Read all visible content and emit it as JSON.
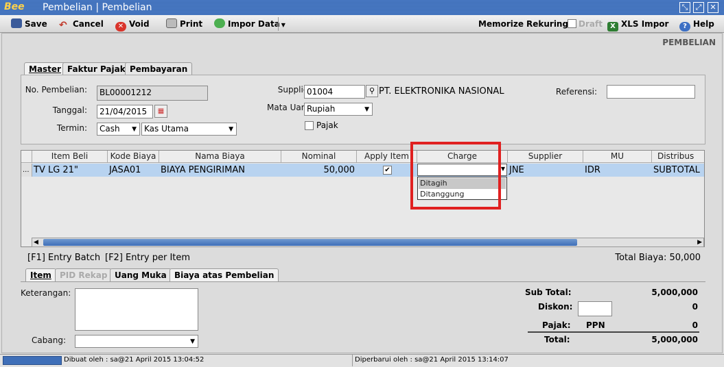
{
  "window": {
    "logo": "Bee",
    "title": "Pembelian | Pembelian"
  },
  "toolbar": {
    "save": "Save",
    "cancel": "Cancel",
    "void": "Void",
    "print": "Print",
    "impor_data": "Impor Data",
    "memorize": "Memorize",
    "rekuring": "Rekuring",
    "draft": "Draft",
    "xls_impor": "XLS Impor",
    "help": "Help"
  },
  "page_heading": "PEMBELIAN",
  "top_tabs": [
    "Master",
    "Faktur Pajak",
    "Pembayaran"
  ],
  "master": {
    "no_pembelian_label": "No. Pembelian:",
    "no_pembelian": "BL00001212",
    "tanggal_label": "Tanggal:",
    "tanggal": "21/04/2015",
    "termin_label": "Termin:",
    "termin": "Cash",
    "kas": "Kas Utama",
    "supplier_label": "Supplier:",
    "supplier_code": "01004",
    "supplier_name": "PT. ELEKTRONIKA NASIONAL",
    "mata_uang_label": "Mata Uang:",
    "mata_uang": "Rupiah",
    "pajak_label": "Pajak",
    "referensi_label": "Referensi:",
    "referensi": ""
  },
  "grid": {
    "columns": [
      "Item Beli",
      "Kode Biaya",
      "Nama Biaya",
      "Nominal",
      "Apply Item",
      "Charge",
      "Supplier",
      "MU",
      "Distribus"
    ],
    "row": {
      "marker": "...",
      "item_beli": "TV LG 21\"",
      "kode_biaya": "JASA01",
      "nama_biaya": "BIAYA PENGIRIMAN",
      "nominal": "50,000",
      "apply_item": true,
      "charge": "",
      "supplier": "JNE",
      "mu": "IDR",
      "distribusi": "SUBTOTAL"
    },
    "charge_options": [
      "Ditagih",
      "Ditanggung"
    ]
  },
  "hints": {
    "f1": "[F1] Entry Batch",
    "f2": "[F2] Entry per Item",
    "total_biaya": "Total Biaya: 50,000"
  },
  "bottom_tabs": [
    "Item",
    "PID Rekap",
    "Uang Muka",
    "Biaya atas Pembelian"
  ],
  "footer": {
    "keterangan_label": "Keterangan:",
    "cabang_label": "Cabang:",
    "sub_total_label": "Sub Total:",
    "sub_total": "5,000,000",
    "diskon_label": "Diskon:",
    "diskon": "0",
    "pajak_label": "Pajak:",
    "pajak_type": "PPN",
    "pajak": "0",
    "total_label": "Total:",
    "total": "5,000,000"
  },
  "status": {
    "dibuat": "Dibuat oleh : sa@21 April 2015  13:04:52",
    "diperbarui": "Diperbarui oleh : sa@21 April 2015  13:14:07"
  },
  "colors": {
    "titlebar": "#3f6fb8",
    "selected_row": "#b8d3f0",
    "highlight_box": "#e02020"
  }
}
